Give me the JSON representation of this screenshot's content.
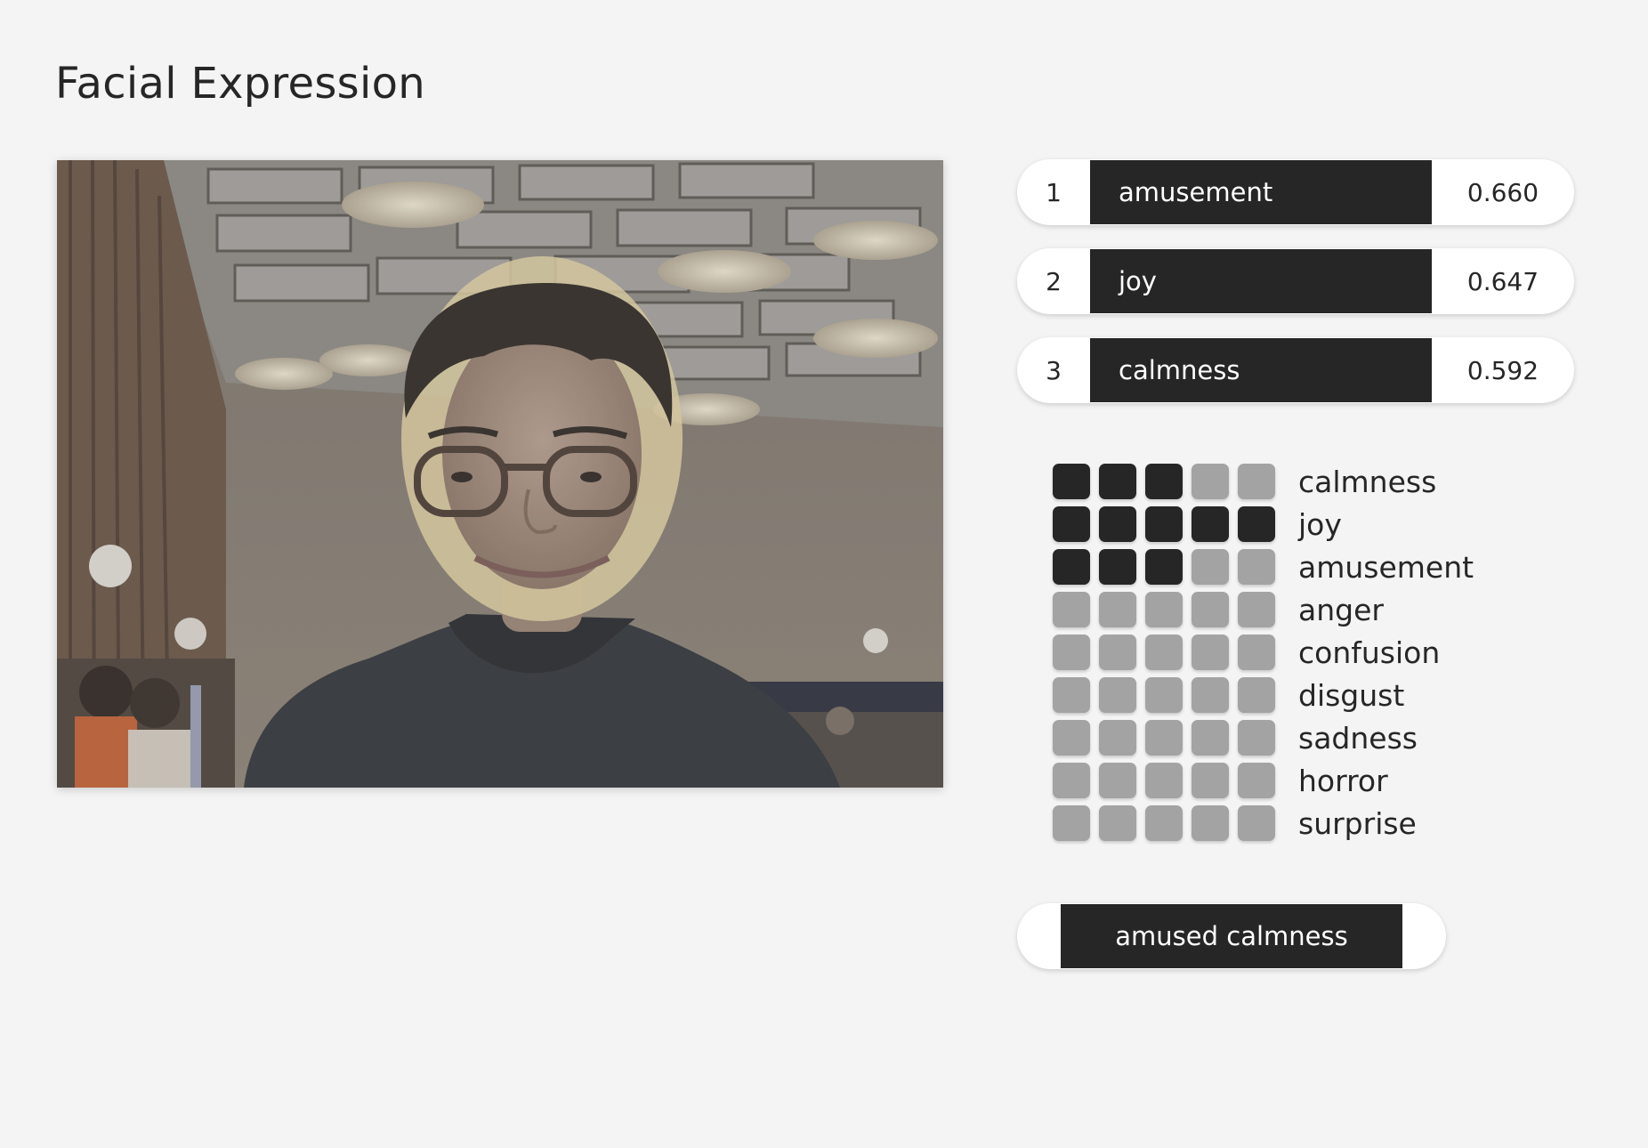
{
  "page": {
    "title": "Facial Expression"
  },
  "top_expressions": [
    {
      "rank": "1",
      "label": "amusement",
      "score": "0.660"
    },
    {
      "rank": "2",
      "label": "joy",
      "score": "0.647"
    },
    {
      "rank": "3",
      "label": "calmness",
      "score": "0.592"
    }
  ],
  "emotion_grid": [
    {
      "label": "calmness",
      "level": 3
    },
    {
      "label": "joy",
      "level": 5
    },
    {
      "label": "amusement",
      "level": 3
    },
    {
      "label": "anger",
      "level": 0
    },
    {
      "label": "confusion",
      "level": 0
    },
    {
      "label": "disgust",
      "level": 0
    },
    {
      "label": "sadness",
      "level": 0
    },
    {
      "label": "horror",
      "level": 0
    },
    {
      "label": "surprise",
      "level": 0
    }
  ],
  "grid_max_level": 5,
  "summary": {
    "label": "amused calmness"
  },
  "colors": {
    "background": "#f4f4f4",
    "dark": "#262626",
    "cell_off": "#a3a3a3",
    "pill": "#ffffff"
  }
}
